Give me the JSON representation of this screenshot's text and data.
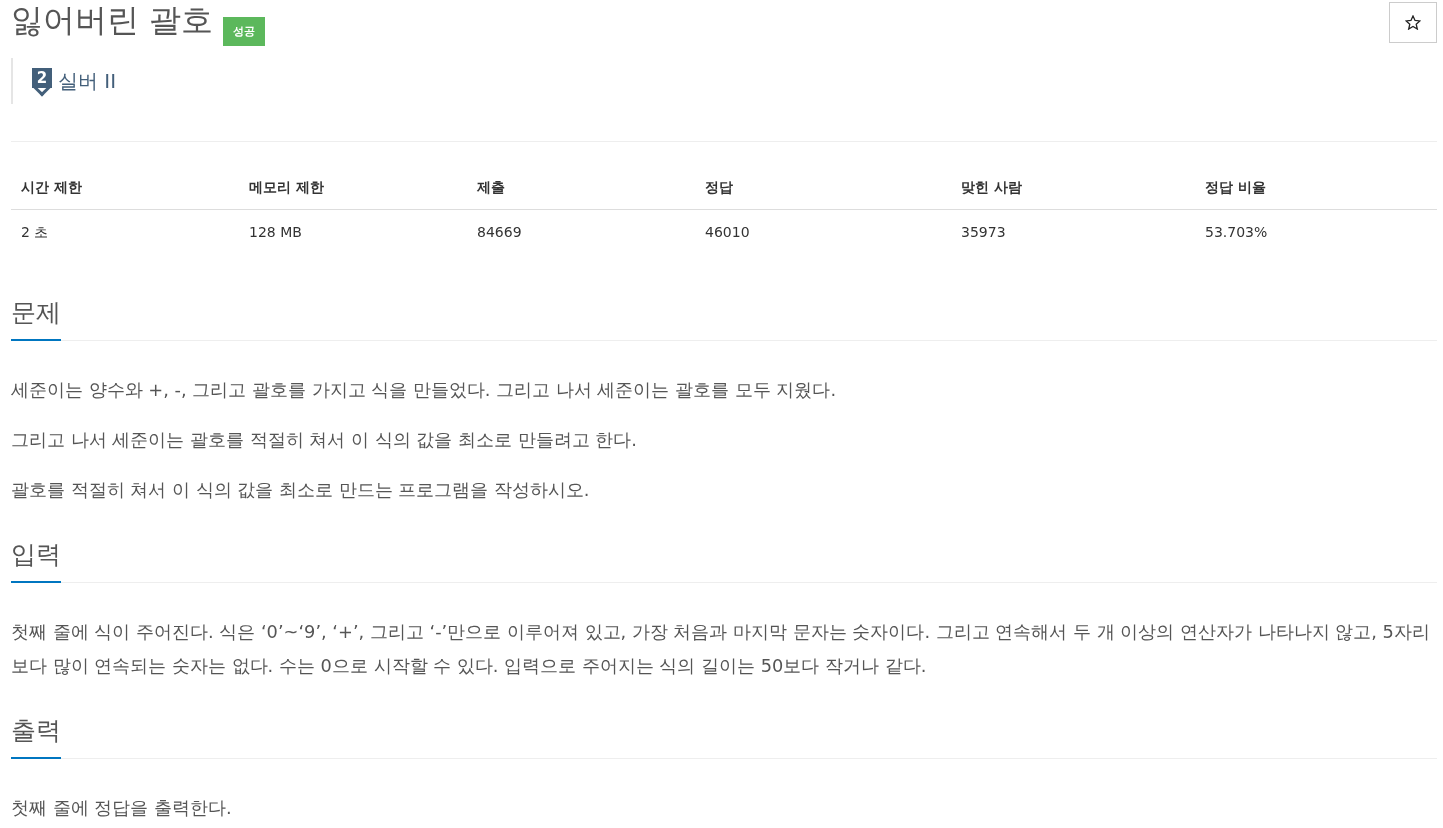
{
  "problem": {
    "title": "잃어버린 괄호",
    "result_badge": {
      "label": "성공"
    },
    "favorite": {
      "starred": false
    }
  },
  "tier": {
    "number": "2",
    "name": "실버 II"
  },
  "stats": {
    "columns": [
      "시간 제한",
      "메모리 제한",
      "제출",
      "정답",
      "맞힌 사람",
      "정답 비율"
    ],
    "rows": [
      [
        "2 초",
        "128 MB",
        "84669",
        "46010",
        "35973",
        "53.703%"
      ]
    ]
  },
  "sections": [
    {
      "heading": "문제",
      "paragraphs": [
        "세준이는 양수와 +, -, 그리고 괄호를 가지고 식을 만들었다. 그리고 나서 세준이는 괄호를 모두 지웠다.",
        "그리고 나서 세준이는 괄호를 적절히 쳐서 이 식의 값을 최소로 만들려고 한다.",
        "괄호를 적절히 쳐서 이 식의 값을 최소로 만드는 프로그램을 작성하시오."
      ]
    },
    {
      "heading": "입력",
      "paragraphs": [
        "첫째 줄에 식이 주어진다. 식은 ‘0’~‘9’, ‘+’, 그리고 ‘-’만으로 이루어져 있고, 가장 처음과 마지막 문자는 숫자이다. 그리고 연속해서 두 개 이상의 연산자가 나타나지 않고, 5자리보다 많이 연속되는 숫자는 없다. 수는 0으로 시작할 수 있다. 입력으로 주어지는 식의 길이는 50보다 작거나 같다."
      ]
    },
    {
      "heading": "출력",
      "paragraphs": [
        "첫째 줄에 정답을 출력한다."
      ]
    }
  ]
}
